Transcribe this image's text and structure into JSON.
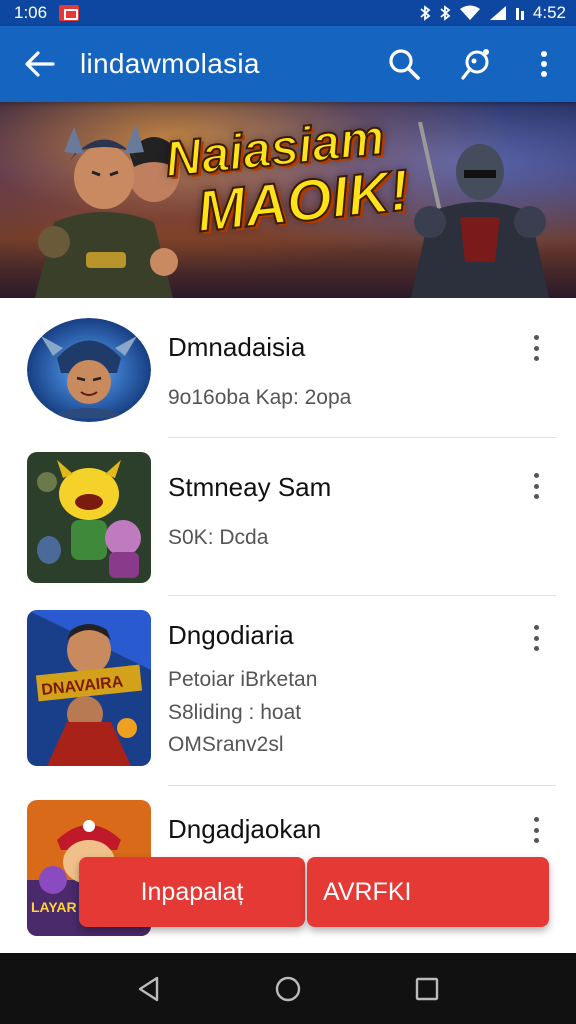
{
  "status_bar": {
    "time": "1:06",
    "battery_text": "4:52"
  },
  "app_bar": {
    "title": "lindawmolasia",
    "icons": [
      "back-arrow-icon",
      "search-icon",
      "share-icon",
      "more-vert-icon"
    ]
  },
  "banner": {
    "line1": "Naiasiam",
    "line2": "MAOIK!"
  },
  "list": {
    "items": [
      {
        "title": "Dmnadaisia",
        "lines": [
          "9o16ob‌a Kap: 2opa"
        ]
      },
      {
        "title": "Stmneay Sam",
        "lines": [
          "S0K: Dcda"
        ]
      },
      {
        "title": "Dngodiaria",
        "lines": [
          "Petoiar iBrketan",
          "S8liding : hoat",
          "OMSranv2sl"
        ]
      },
      {
        "title": "Dngadjaokan",
        "lines": []
      }
    ]
  },
  "actions": {
    "install_label": "Inpapalaț",
    "apk_label": "AVRFKI"
  },
  "colors": {
    "app_bar": "#1565c0",
    "status_bar": "#0d47a1",
    "accent_red": "#e53935",
    "nav_bar": "#111111"
  }
}
